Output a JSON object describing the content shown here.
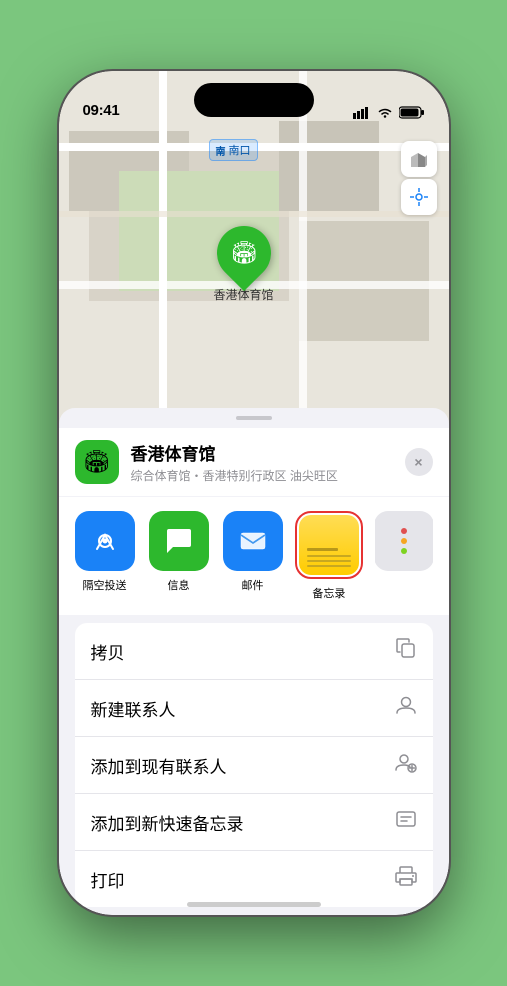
{
  "status_bar": {
    "time": "09:41",
    "signal_bars": "signal-icon",
    "wifi": "wifi-icon",
    "battery": "battery-icon"
  },
  "map": {
    "label_prefix": "南口",
    "location_name": "香港体育馆",
    "controls": {
      "map_type": "map-type-icon",
      "location": "location-icon"
    }
  },
  "place_card": {
    "name": "香港体育馆",
    "description": "综合体育馆・香港特别行政区 油尖旺区",
    "close_label": "×"
  },
  "share_apps": [
    {
      "id": "airdrop",
      "label": "隔空投送",
      "type": "airdrop"
    },
    {
      "id": "messages",
      "label": "信息",
      "type": "messages"
    },
    {
      "id": "mail",
      "label": "邮件",
      "type": "mail"
    },
    {
      "id": "notes",
      "label": "备忘录",
      "type": "notes"
    }
  ],
  "actions": [
    {
      "id": "copy",
      "label": "拷贝",
      "icon": "copy-icon"
    },
    {
      "id": "new-contact",
      "label": "新建联系人",
      "icon": "new-contact-icon"
    },
    {
      "id": "add-existing",
      "label": "添加到现有联系人",
      "icon": "add-contact-icon"
    },
    {
      "id": "quick-note",
      "label": "添加到新快速备忘录",
      "icon": "quick-note-icon"
    },
    {
      "id": "print",
      "label": "打印",
      "icon": "print-icon"
    }
  ]
}
